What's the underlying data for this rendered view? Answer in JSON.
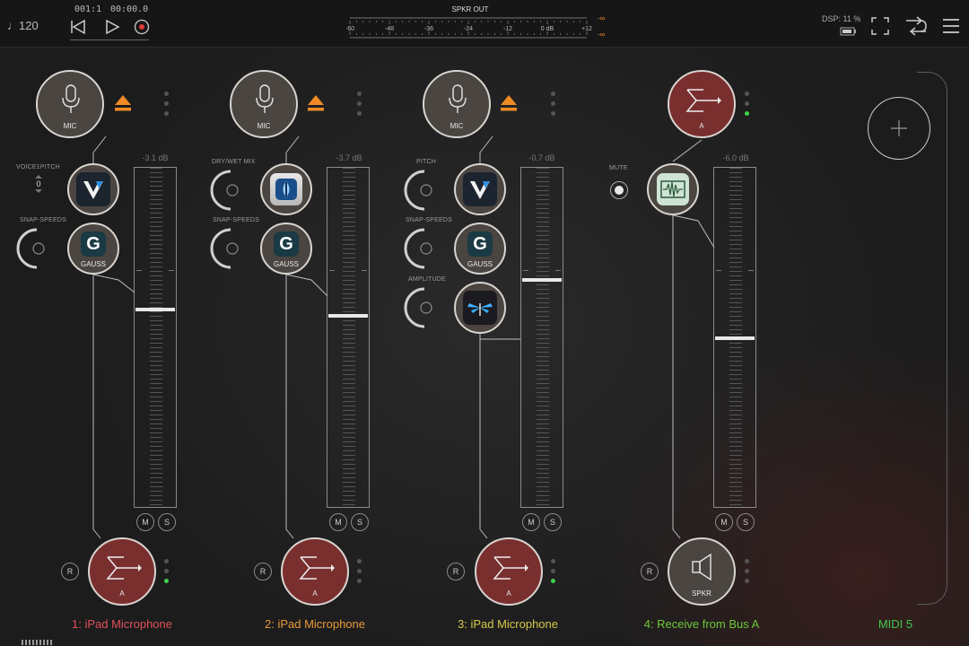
{
  "transport": {
    "tempo": "♩120",
    "position": "001:1",
    "time": "00:00.0"
  },
  "meter": {
    "title": "SPKR OUT",
    "ticks": [
      "-60",
      "-48",
      "-36",
      "-24",
      "-12",
      "0 dB",
      "+12"
    ],
    "peak_left": "-∞",
    "peak_right": "-∞"
  },
  "status": {
    "dsp": "DSP: 11 %"
  },
  "channels": [
    {
      "title": "1: iPad Microphone",
      "title_color": "#e0505a",
      "source_label": "MIC",
      "db": "-3.1 dB",
      "fader_level_db": -3.1,
      "params": [
        {
          "label": "VOICE1PITCH",
          "value": "0"
        },
        {
          "label": "SNAP-SPEEDS"
        }
      ],
      "fx": [
        {
          "label": ""
        },
        {
          "label": "GAUSS"
        }
      ],
      "mute_label": "M",
      "solo_label": "S",
      "record_label": "R",
      "output_label": "A"
    },
    {
      "title": "2: iPad Microphone",
      "title_color": "#e89a3a",
      "source_label": "MIC",
      "db": "-3.7 dB",
      "fader_level_db": -3.7,
      "params": [
        {
          "label": "DRY/WET MIX"
        },
        {
          "label": "SNAP-SPEEDS"
        }
      ],
      "fx": [
        {
          "label": ""
        },
        {
          "label": "GAUSS"
        }
      ],
      "mute_label": "M",
      "solo_label": "S",
      "record_label": "R",
      "output_label": "A"
    },
    {
      "title": "3: iPad Microphone",
      "title_color": "#d8c84a",
      "source_label": "MIC",
      "db": "-0.7 dB",
      "fader_level_db": -0.7,
      "params": [
        {
          "label": "PITCH"
        },
        {
          "label": "SNAP-SPEEDS"
        },
        {
          "label": "AMPLITUDE"
        }
      ],
      "fx": [
        {
          "label": ""
        },
        {
          "label": "GAUSS"
        },
        {
          "label": ""
        }
      ],
      "mute_label": "M",
      "solo_label": "S",
      "record_label": "R",
      "output_label": "A"
    },
    {
      "title": "4: Receive from Bus A",
      "title_color": "#6cc83a",
      "source_label": "A",
      "db": "-6.0 dB",
      "fader_level_db": -6.0,
      "params": [
        {
          "label": "MUTE"
        }
      ],
      "fx": [
        {
          "label": ""
        }
      ],
      "mute_label": "M",
      "solo_label": "S",
      "record_label": "R",
      "output_label": "SPKR"
    }
  ],
  "midi": {
    "title": "MIDI 5",
    "title_color": "#3fc84a"
  },
  "colors": {
    "accent_orange": "#f08a24",
    "bus_red": "#7a2f2f",
    "node_gray": "#4a4540",
    "active_green": "#3fd14a"
  },
  "icons": {
    "mic": "microphone-icon",
    "eject": "eject-icon",
    "sum": "sigma-arrow-icon",
    "speaker": "speaker-icon",
    "add": "plus-icon"
  }
}
